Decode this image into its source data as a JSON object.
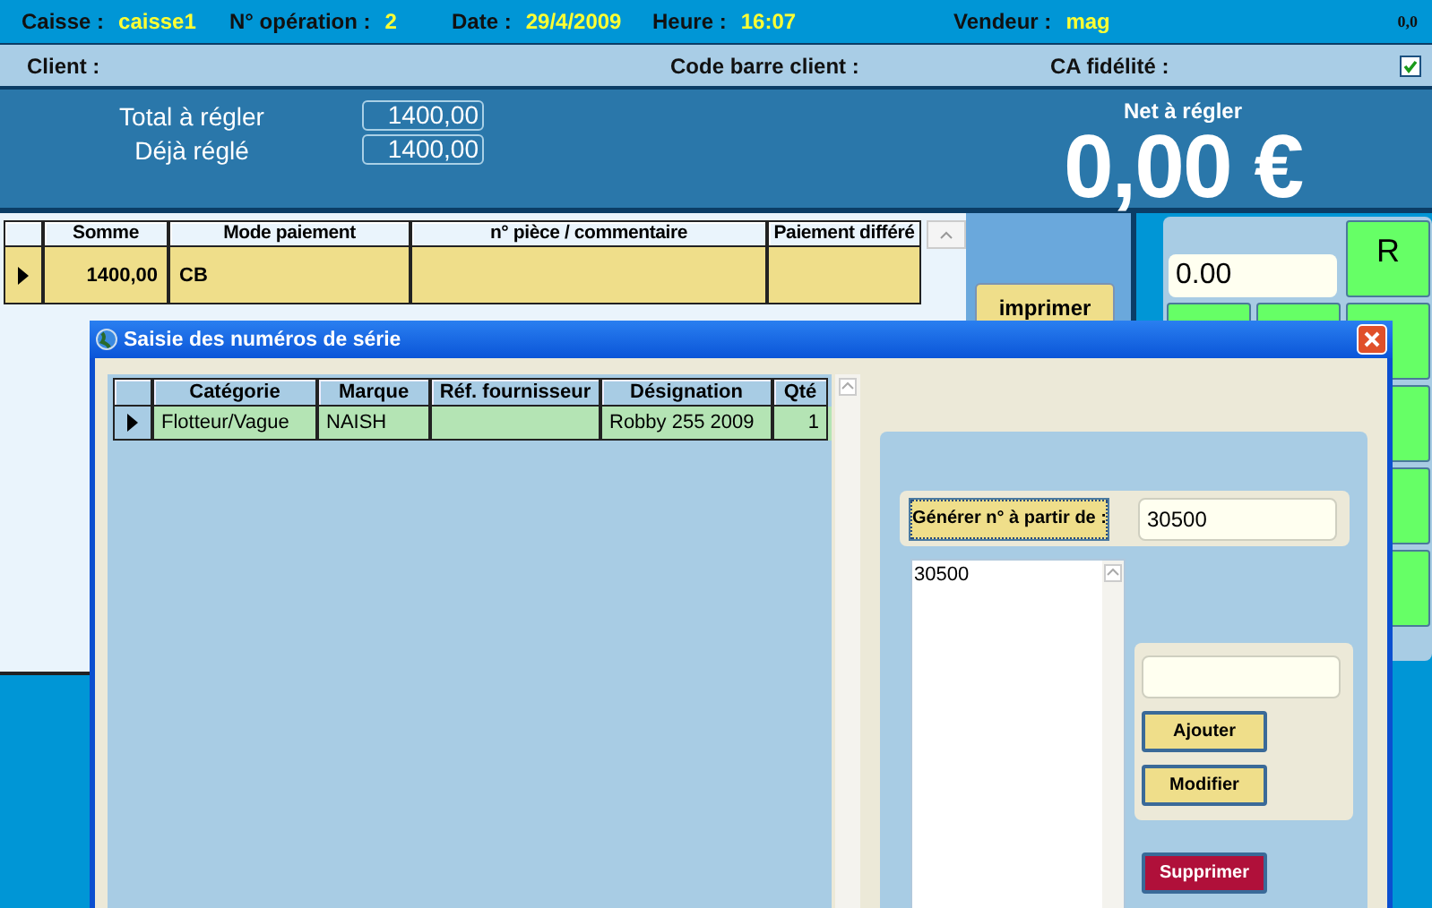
{
  "header": {
    "fields": [
      {
        "label": "Caisse :",
        "value": "caisse1"
      },
      {
        "label": "N° opération :",
        "value": "2"
      },
      {
        "label": "Date :",
        "value": "29/4/2009"
      },
      {
        "label": "Heure :",
        "value": "16:07"
      },
      {
        "label": "Vendeur :",
        "value": "mag"
      }
    ],
    "corner": "0,0"
  },
  "client_bar": {
    "client_label": "Client :",
    "barcode_label": "Code barre client :",
    "loyalty_label": "CA fidélité :",
    "loyalty_checked": true
  },
  "totals": {
    "rows": [
      {
        "label": "Total à régler",
        "value": "1400,00"
      },
      {
        "label": "Déjà réglé",
        "value": "1400,00"
      }
    ],
    "net_label": "Net à régler",
    "net_value": "0,00 €"
  },
  "payments": {
    "columns": [
      "Somme",
      "Mode paiement",
      "n° pièce / commentaire",
      "Paiement différé"
    ],
    "rows": [
      {
        "selected": true,
        "amount": "1400,00",
        "mode": "CB"
      }
    ]
  },
  "print_button": "imprimer",
  "keypad": {
    "display": "0.00",
    "key_label": "R"
  },
  "dialog": {
    "title": "Saisie des numéros de série",
    "columns": [
      "Catégorie",
      "Marque",
      "Réf. fournisseur",
      "Désignation",
      "Qté"
    ],
    "rows": [
      {
        "selected": true,
        "category": "Flotteur/Vague",
        "brand": "NAISH",
        "designation": "Robby 255 2009",
        "qty": "1"
      }
    ],
    "generate_button": "Générer n° à partir de :",
    "start_value": "30500",
    "serials": [
      "30500"
    ],
    "add_button": "Ajouter",
    "edit_button": "Modifier",
    "delete_button": "Supprimer"
  }
}
